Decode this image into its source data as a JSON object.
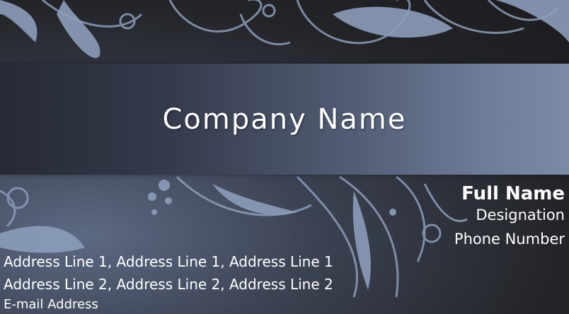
{
  "card": {
    "company_name": "Company Name",
    "full_name": "Full Name",
    "designation": "Designation",
    "phone_number": "Phone Number",
    "address_line_1": "Address Line 1,  Address Line 1,  Address Line 1",
    "address_line_2": "Address Line 2,  Address Line 2,  Address Line 2",
    "email": "E-mail Address"
  },
  "colors": {
    "background_dark": "#1c1c1f",
    "band_left": "#262a35",
    "band_right": "#7b8aa5",
    "swirl": "#8a9bb8",
    "text": "#ffffff"
  }
}
